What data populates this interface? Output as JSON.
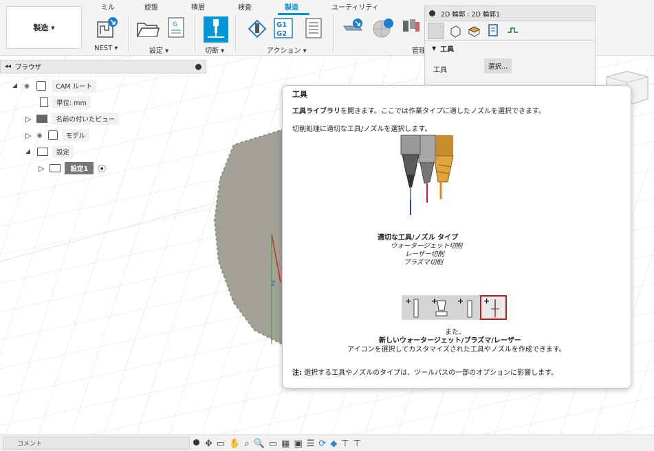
{
  "workspace": {
    "label": "製造 ▾"
  },
  "tabs": [
    "ミル",
    "旋盤",
    "積層",
    "検査",
    "製造",
    "ユーティリティ"
  ],
  "active_tab": "製造",
  "groups": {
    "nest": "NEST ▾",
    "setup": "設定 ▾",
    "cut": "切断 ▾",
    "actions": "アクション ▾",
    "manage": "管理"
  },
  "browser": {
    "title": "ブラウザ",
    "items": {
      "cam_root": "CAM ルート",
      "units": "単位: mm",
      "named_views": "名前の付いたビュー",
      "models": "モデル",
      "setups": "設定",
      "setup1": "設定1"
    }
  },
  "props_panel": {
    "title": "2D 輪郭 : 2D 輪郭1",
    "section": "工具",
    "tool_label": "工具",
    "select_button": "選択..."
  },
  "tooltip": {
    "title": "工具",
    "intro_bold": "工具ライブラリ",
    "intro_rest": "を開きます。ここでは作業タイプに適したノズルを選択できます。",
    "line2": "切削処理に適切な工具/ノズルを選択します。",
    "caption_bold": "適切な工具/ノズル タイプ",
    "caption_items": [
      "ウォータージェット切削",
      "レーザー切削",
      "プラズマ切削"
    ],
    "also": "また、",
    "new_bold": "新しいウォータージェット/プラズマ/レーザー",
    "new_rest": "アイコンを選択してカスタマイズされた工具やノズルを作成できます。",
    "note_bold": "注:",
    "note_rest": " 選択する工具やノズルのタイプは、ツールパスの一部のオプションに影響します。"
  },
  "comment_label": "コメント",
  "axis_label": "Z"
}
